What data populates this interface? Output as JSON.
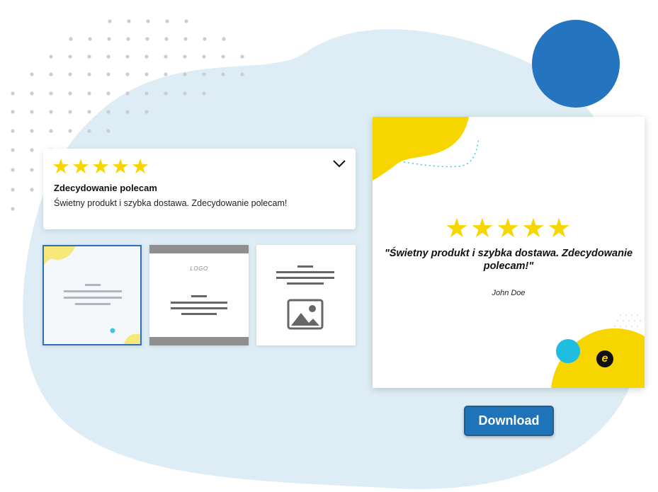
{
  "review_card": {
    "stars": [
      "★",
      "★",
      "★",
      "★",
      "★"
    ],
    "rating": 5,
    "title": "Zdecydowanie polecam",
    "body": "Świetny produkt i szybka dostawa. Zdecydowanie polecam!",
    "chevron_icon": "chevron-down-icon"
  },
  "templates": {
    "selected_index": 0,
    "items": [
      {
        "name": "template-blob",
        "icon": "text-lines-icon"
      },
      {
        "name": "template-logo",
        "logo_text": "LOGO"
      },
      {
        "name": "template-image",
        "icon": "image-placeholder-icon"
      }
    ]
  },
  "preview": {
    "stars": "★★★★★",
    "quote": "\"Świetny produkt i szybka dostawa. Zdecydowanie polecam!\"",
    "author": "John Doe",
    "badge_letter": "e"
  },
  "download": {
    "label": "Download"
  },
  "colors": {
    "accent_yellow": "#f7d600",
    "accent_blue": "#2474bf",
    "accent_cyan": "#1fbde0",
    "background_blob": "#deedf5",
    "button": "#1f73b8"
  }
}
